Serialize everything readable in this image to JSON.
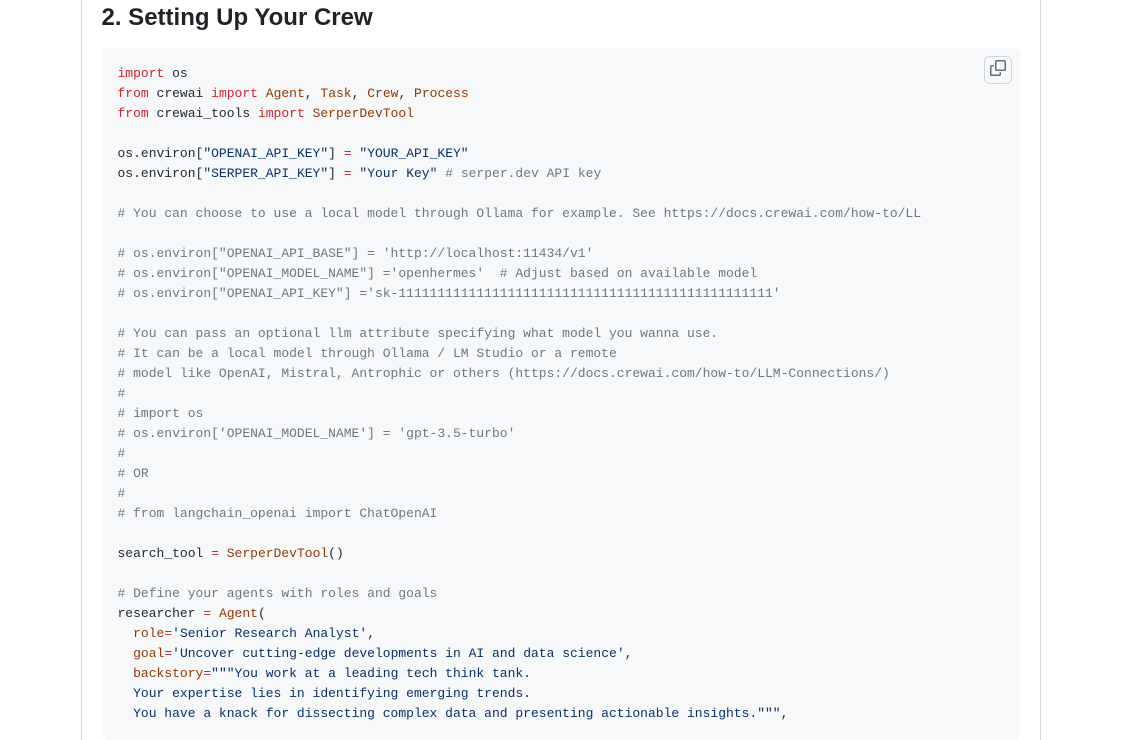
{
  "heading": "2. Setting Up Your Crew",
  "code": {
    "tokens": [
      {
        "t": "import",
        "c": "pl-k"
      },
      {
        "t": " os\n"
      },
      {
        "t": "from",
        "c": "pl-k"
      },
      {
        "t": " crewai "
      },
      {
        "t": "import",
        "c": "pl-k"
      },
      {
        "t": " "
      },
      {
        "t": "Agent",
        "c": "pl-v"
      },
      {
        "t": ", "
      },
      {
        "t": "Task",
        "c": "pl-v"
      },
      {
        "t": ", "
      },
      {
        "t": "Crew",
        "c": "pl-v"
      },
      {
        "t": ", "
      },
      {
        "t": "Process",
        "c": "pl-v"
      },
      {
        "t": "\n"
      },
      {
        "t": "from",
        "c": "pl-k"
      },
      {
        "t": " crewai_tools "
      },
      {
        "t": "import",
        "c": "pl-k"
      },
      {
        "t": " "
      },
      {
        "t": "SerperDevTool",
        "c": "pl-v"
      },
      {
        "t": "\n"
      },
      {
        "t": "\n"
      },
      {
        "t": "os.environ["
      },
      {
        "t": "\"OPENAI_API_KEY\"",
        "c": "pl-s"
      },
      {
        "t": "] "
      },
      {
        "t": "=",
        "c": "pl-k"
      },
      {
        "t": " "
      },
      {
        "t": "\"YOUR_API_KEY\"",
        "c": "pl-s"
      },
      {
        "t": "\n"
      },
      {
        "t": "os.environ["
      },
      {
        "t": "\"SERPER_API_KEY\"",
        "c": "pl-s"
      },
      {
        "t": "] "
      },
      {
        "t": "=",
        "c": "pl-k"
      },
      {
        "t": " "
      },
      {
        "t": "\"Your Key\"",
        "c": "pl-s"
      },
      {
        "t": " "
      },
      {
        "t": "# serper.dev API key",
        "c": "pl-c"
      },
      {
        "t": "\n"
      },
      {
        "t": "\n"
      },
      {
        "t": "# You can choose to use a local model through Ollama for example. See https://docs.crewai.com/how-to/LL",
        "c": "pl-c"
      },
      {
        "t": "\n"
      },
      {
        "t": "\n"
      },
      {
        "t": "# os.environ[\"OPENAI_API_BASE\"] = 'http://localhost:11434/v1'",
        "c": "pl-c"
      },
      {
        "t": "\n"
      },
      {
        "t": "# os.environ[\"OPENAI_MODEL_NAME\"] ='openhermes'  # Adjust based on available model",
        "c": "pl-c"
      },
      {
        "t": "\n"
      },
      {
        "t": "# os.environ[\"OPENAI_API_KEY\"] ='sk-111111111111111111111111111111111111111111111111'",
        "c": "pl-c"
      },
      {
        "t": "\n"
      },
      {
        "t": "\n"
      },
      {
        "t": "# You can pass an optional llm attribute specifying what model you wanna use.",
        "c": "pl-c"
      },
      {
        "t": "\n"
      },
      {
        "t": "# It can be a local model through Ollama / LM Studio or a remote",
        "c": "pl-c"
      },
      {
        "t": "\n"
      },
      {
        "t": "# model like OpenAI, Mistral, Antrophic or others (https://docs.crewai.com/how-to/LLM-Connections/)",
        "c": "pl-c"
      },
      {
        "t": "\n"
      },
      {
        "t": "#",
        "c": "pl-c"
      },
      {
        "t": "\n"
      },
      {
        "t": "# import os",
        "c": "pl-c"
      },
      {
        "t": "\n"
      },
      {
        "t": "# os.environ['OPENAI_MODEL_NAME'] = 'gpt-3.5-turbo'",
        "c": "pl-c"
      },
      {
        "t": "\n"
      },
      {
        "t": "#",
        "c": "pl-c"
      },
      {
        "t": "\n"
      },
      {
        "t": "# OR",
        "c": "pl-c"
      },
      {
        "t": "\n"
      },
      {
        "t": "#",
        "c": "pl-c"
      },
      {
        "t": "\n"
      },
      {
        "t": "# from langchain_openai import ChatOpenAI",
        "c": "pl-c"
      },
      {
        "t": "\n"
      },
      {
        "t": "\n"
      },
      {
        "t": "search_tool "
      },
      {
        "t": "=",
        "c": "pl-k"
      },
      {
        "t": " "
      },
      {
        "t": "SerperDevTool",
        "c": "pl-v"
      },
      {
        "t": "()\n"
      },
      {
        "t": "\n"
      },
      {
        "t": "# Define your agents with roles and goals",
        "c": "pl-c"
      },
      {
        "t": "\n"
      },
      {
        "t": "researcher "
      },
      {
        "t": "=",
        "c": "pl-k"
      },
      {
        "t": " "
      },
      {
        "t": "Agent",
        "c": "pl-v"
      },
      {
        "t": "(\n"
      },
      {
        "t": "  "
      },
      {
        "t": "role",
        "c": "pl-v"
      },
      {
        "t": "=",
        "c": "pl-k"
      },
      {
        "t": "'Senior Research Analyst'",
        "c": "pl-s"
      },
      {
        "t": ",\n"
      },
      {
        "t": "  "
      },
      {
        "t": "goal",
        "c": "pl-v"
      },
      {
        "t": "=",
        "c": "pl-k"
      },
      {
        "t": "'Uncover cutting-edge developments in AI and data science'",
        "c": "pl-s"
      },
      {
        "t": ",\n"
      },
      {
        "t": "  "
      },
      {
        "t": "backstory",
        "c": "pl-v"
      },
      {
        "t": "=",
        "c": "pl-k"
      },
      {
        "t": "\"\"\"You work at a leading tech think tank.",
        "c": "pl-s"
      },
      {
        "t": "\n"
      },
      {
        "t": "  Your expertise lies in identifying emerging trends.",
        "c": "pl-s"
      },
      {
        "t": "\n"
      },
      {
        "t": "  You have a knack for dissecting complex data and presenting actionable insights.\"\"\"",
        "c": "pl-s"
      },
      {
        "t": ","
      }
    ]
  }
}
